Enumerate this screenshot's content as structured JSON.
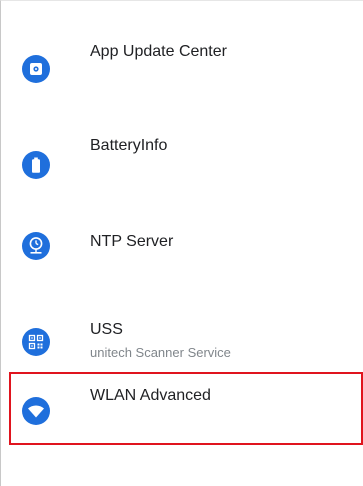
{
  "settings_list": {
    "items": [
      {
        "title": "App Update Center",
        "subtitle": "",
        "icon": "app-update-icon"
      },
      {
        "title": "BatteryInfo",
        "subtitle": "",
        "icon": "battery-icon"
      },
      {
        "title": "NTP Server",
        "subtitle": "",
        "icon": "ntp-clock-icon"
      },
      {
        "title": "USS",
        "subtitle": "unitech Scanner Service",
        "icon": "qr-code-icon"
      },
      {
        "title": "WLAN Advanced",
        "subtitle": "",
        "icon": "wifi-icon"
      }
    ]
  },
  "colors": {
    "icon_blue": "#1f6fdc",
    "highlight_red": "#e0141e",
    "title_text": "#202124",
    "subtitle_text": "#80868b"
  }
}
